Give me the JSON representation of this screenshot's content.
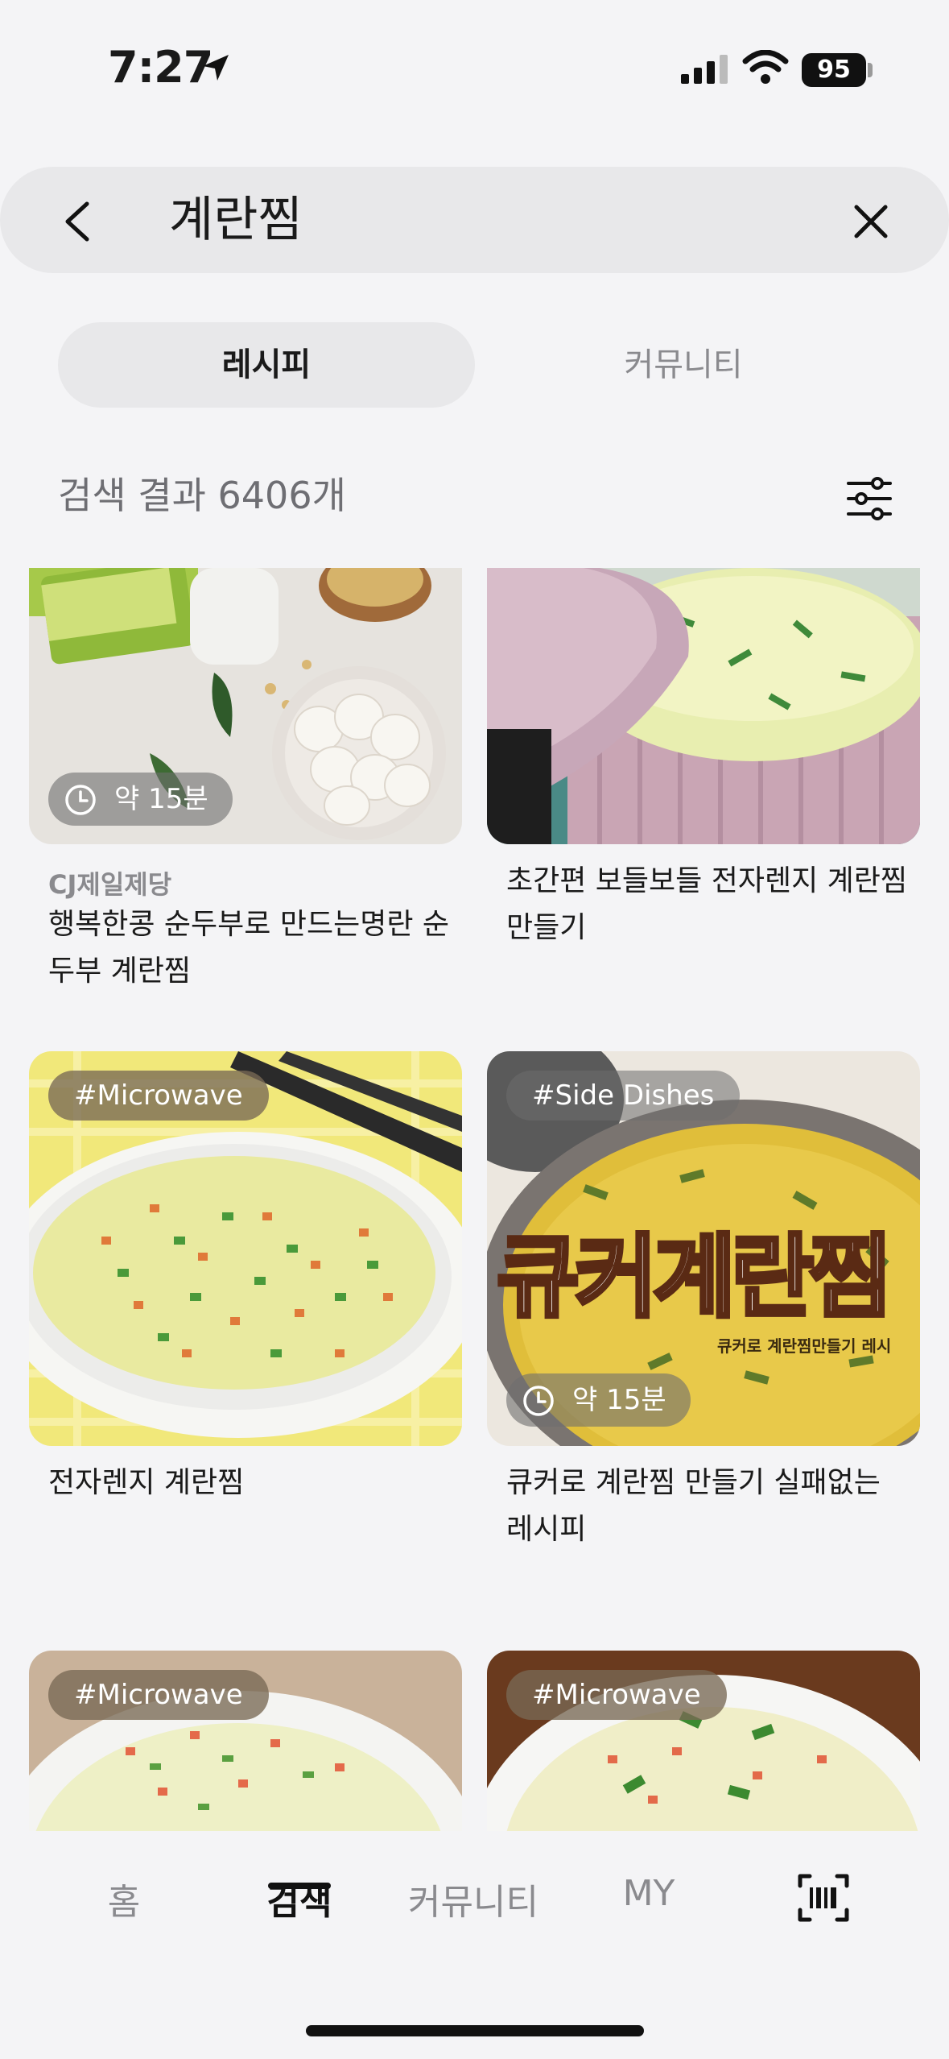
{
  "status_bar": {
    "time": "7:27",
    "battery": "95"
  },
  "search": {
    "query": "계란찜"
  },
  "tabs": [
    {
      "label": "레시피",
      "selected": true
    },
    {
      "label": "커뮤니티",
      "selected": false
    }
  ],
  "results": {
    "count_text": "검색 결과 6406개"
  },
  "cards": [
    {
      "brand": "CJ제일제당",
      "title": "행복한콩 순두부로 만드는명란 순두부 계란찜",
      "time": "약 15분"
    },
    {
      "title": "초간편 보들보들 전자렌지 계란찜 만들기"
    },
    {
      "tag": "#Microwave",
      "title": "전자렌지 계란찜"
    },
    {
      "tag": "#Side Dishes",
      "title": "큐커로 계란찜 만들기 실패없는 레시피",
      "time": "약 15분",
      "overlay_text": "큐커계란찜",
      "overlay_sub": "큐커로 계란찜만들기 레시"
    },
    {
      "tag": "#Microwave"
    },
    {
      "tag": "#Microwave"
    }
  ],
  "bottom_nav": [
    {
      "label": "홈",
      "active": false
    },
    {
      "label": "검색",
      "active": true
    },
    {
      "label": "커뮤니티",
      "active": false
    },
    {
      "label": "MY",
      "active": false
    }
  ],
  "colors": {
    "background": "#f4f4f6",
    "chip": "#e8e8ea",
    "muted": "#8a8a8e",
    "tag_bg": "#786955"
  }
}
